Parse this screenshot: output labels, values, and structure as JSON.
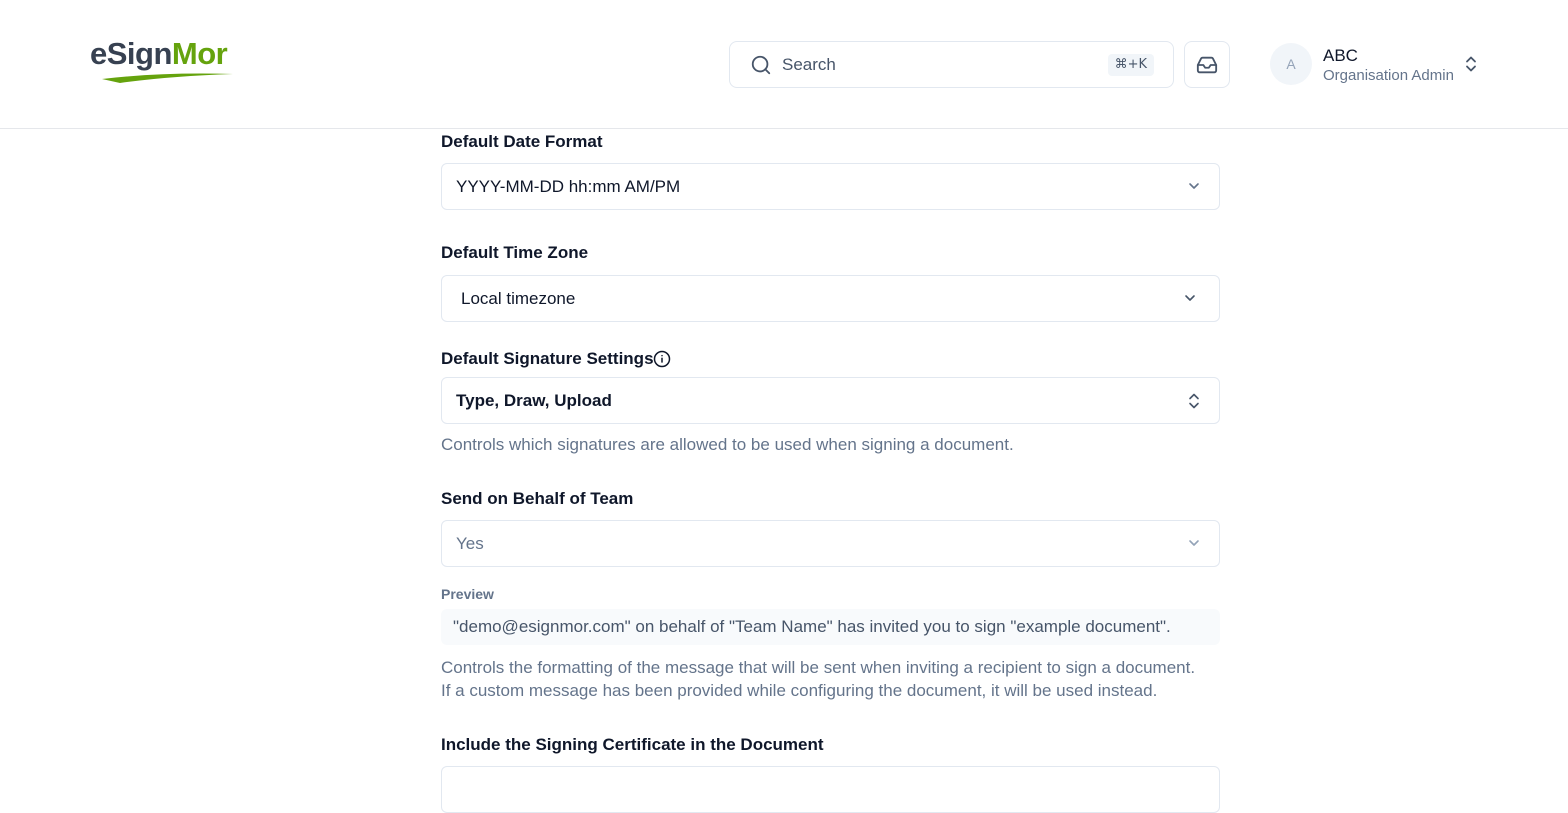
{
  "header": {
    "logo": {
      "prefix": "eS",
      "middle": "ign",
      "suffix": "Mor"
    },
    "search": {
      "label": "Search",
      "shortcut": "⌘+K",
      "icon": "search-icon"
    },
    "inbox_icon": "inbox-icon",
    "user": {
      "initial": "A",
      "name": "ABC",
      "role": "Organisation Admin"
    }
  },
  "form": {
    "date_format": {
      "label": "Default Date Format",
      "value": "YYYY-MM-DD hh:mm AM/PM"
    },
    "time_zone": {
      "label": "Default Time Zone",
      "value": "Local timezone"
    },
    "signature": {
      "label": "Default Signature Settings",
      "value": "Type, Draw, Upload",
      "help": "Controls which signatures are allowed to be used when signing a document."
    },
    "send_on_behalf": {
      "label": "Send on Behalf of Team",
      "value": "Yes",
      "preview_label": "Preview",
      "preview_text": "\"demo@esignmor.com\" on behalf of \"Team Name\" has invited you to sign \"example document\".",
      "help_line1": "Controls the formatting of the message that will be sent when inviting a recipient to sign a document.",
      "help_line2": "If a custom message has been provided while configuring the document, it will be used instead."
    },
    "signing_certificate": {
      "label": "Include the Signing Certificate in the Document"
    }
  },
  "colors": {
    "brand_green": "#65a30d",
    "brand_gray": "#374151",
    "border": "#e2e8f0",
    "muted_text": "#64748b"
  }
}
